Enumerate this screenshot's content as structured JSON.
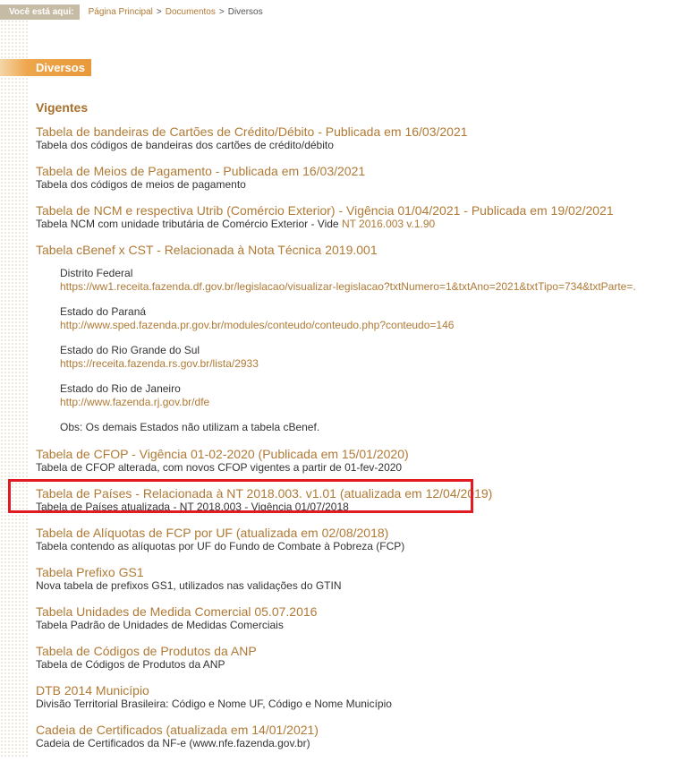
{
  "breadcrumb": {
    "here_label": "Você está aqui:",
    "home": "Página Principal",
    "level2": "Documentos",
    "current": "Diversos",
    "separator": ">"
  },
  "section": {
    "title": "Diversos"
  },
  "vigentes": {
    "heading": "Vigentes"
  },
  "items": [
    {
      "title": "Tabela de bandeiras de Cartões de Crédito/Débito - Publicada em 16/03/2021",
      "desc": "Tabela dos códigos de bandeiras dos cartões de crédito/débito"
    },
    {
      "title": "Tabela de Meios de Pagamento - Publicada em 16/03/2021",
      "desc": "Tabela dos códigos de meios de pagamento"
    },
    {
      "title": "Tabela de NCM e respectiva Utrib (Comércio Exterior) - Vigência 01/04/2021 - Publicada em 19/02/2021",
      "desc": "Tabela NCM com unidade tributária de Comércio Exterior - Vide ",
      "desc_link": "NT 2016.003 v.1.90"
    },
    {
      "title": "Tabela cBenef x CST - Relacionada à Nota Técnica 2019.001"
    },
    {
      "title": "Tabela de CFOP - Vigência 01-02-2020 (Publicada em 15/01/2020)",
      "desc": "Tabela de CFOP alterada, com novos CFOP vigentes a partir de 01-fev-2020"
    },
    {
      "title": "Tabela de Países - Relacionada à NT 2018.003. v1.01 (atualizada em 12/04/2019)",
      "desc": "Tabela de Países atualizada - NT 2018.003 - Vigência 01/07/2018"
    },
    {
      "title": "Tabela de Alíquotas de FCP por UF (atualizada em 02/08/2018)",
      "desc": "Tabela contendo as alíquotas por UF do Fundo de Combate à Pobreza (FCP)"
    },
    {
      "title": "Tabela Prefixo GS1",
      "desc": "Nova tabela de prefixos GS1, utilizados nas validações do GTIN"
    },
    {
      "title": "Tabela Unidades de Medida Comercial 05.07.2016",
      "desc": "Tabela Padrão de Unidades de Medidas Comerciais"
    },
    {
      "title": "Tabela de Códigos de Produtos da ANP",
      "desc": "Tabela de Códigos de Produtos da ANP"
    },
    {
      "title": "DTB 2014 Município",
      "desc": "Divisão Territorial Brasileira: Código e Nome UF, Código e Nome Município"
    },
    {
      "title": "Cadeia de Certificados (atualizada em 14/01/2021)",
      "desc": "Cadeia de Certificados da NF-e (www.nfe.fazenda.gov.br)"
    }
  ],
  "cbenef": {
    "states": [
      {
        "label": "Distrito Federal",
        "url": "https://ww1.receita.fazenda.df.gov.br/legislacao/visualizar-legislacao?txtNumero=1&txtAno=2021&txtTipo=734&txtParte=."
      },
      {
        "label": "Estado do Paraná",
        "url": "http://www.sped.fazenda.pr.gov.br/modules/conteudo/conteudo.php?conteudo=146"
      },
      {
        "label": "Estado do Rio Grande do Sul",
        "url": "https://receita.fazenda.rs.gov.br/lista/2933"
      },
      {
        "label": "Estado do Rio de Janeiro",
        "url": "http://www.fazenda.rj.gov.br/dfe"
      }
    ],
    "obs": "Obs: Os demais Estados não utilizam a tabela cBenef."
  },
  "colors": {
    "link": "#b07a35",
    "accent": "#e8993a",
    "highlight": "#e21b23"
  }
}
